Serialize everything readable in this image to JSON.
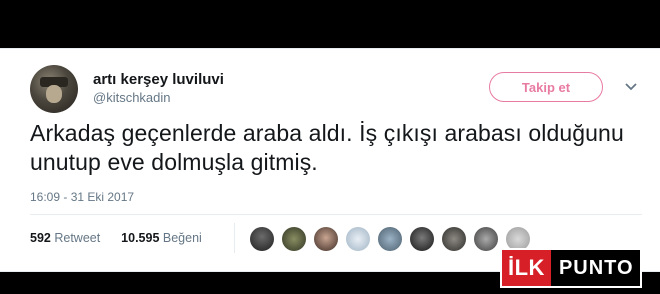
{
  "tweet": {
    "display_name": "artı kerşey luviluvi",
    "handle": "@kitschkadin",
    "follow_label": "Takip et",
    "text": "Arkadaş geçenlerde araba aldı. İş çıkışı arabası olduğunu unutup eve dolmuşla gitmiş.",
    "timestamp": "16:09 - 31 Eki 2017",
    "retweet_count": "592",
    "retweet_label": "Retweet",
    "like_count": "10.595",
    "like_label": "Beğeni"
  },
  "colors": {
    "follow_accent": "#e87ba2",
    "text_primary": "#14171a",
    "text_secondary": "#657786",
    "logo_red": "#d61f26"
  },
  "logo": {
    "part1": "İLK",
    "part2": "PUNTO"
  },
  "icons": [
    "chevron-down-icon"
  ]
}
